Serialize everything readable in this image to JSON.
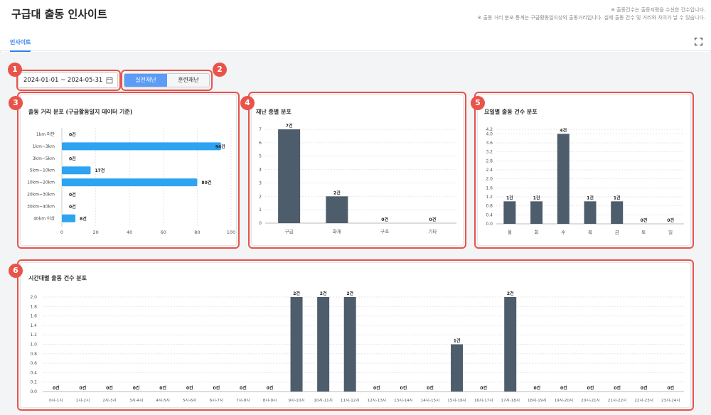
{
  "header": {
    "title": "구급대 출동 인사이트",
    "note1": "※ 출동건수는 출동지령을 수신한 건수입니다.",
    "note2": "※ 출동 거리 분포 통계는 구급활동일지상의 출동거리입니다. 실제 출동 건수 및 거리와 차이가 날 수 있습니다.",
    "tab": "인사이트"
  },
  "filters": {
    "date_range": "2024-01-01 ~ 2024-05-31",
    "toggle_on": "실전재난",
    "toggle_off": "훈련재난"
  },
  "badges": [
    "1",
    "2",
    "3",
    "4",
    "5",
    "6"
  ],
  "cards": {
    "distance": {
      "title": "출동 거리 분포 (구급활동일지 데이터 기준)"
    },
    "type": {
      "title": "재난 종별 분포"
    },
    "weekday": {
      "title": "요일별 출동 건수 분포"
    },
    "hourly": {
      "title": "시간대별 출동 건수 분포"
    }
  },
  "colors": {
    "accent": "#2f80ed",
    "hbar": "#2ea3f2",
    "vbar": "#4e5d6c",
    "callout": "#e8534a"
  },
  "chart_data": [
    {
      "id": "distance",
      "type": "bar",
      "orientation": "horizontal",
      "categories": [
        "1km 미만",
        "1km~3km",
        "3km~5km",
        "5km~10km",
        "10km~20km",
        "20km~30km",
        "30km~40km",
        "40km 이상"
      ],
      "values": [
        0,
        94,
        0,
        17,
        80,
        0,
        0,
        8
      ],
      "labels": [
        "0건",
        "94건",
        "0건",
        "17건",
        "80건",
        "0건",
        "0건",
        "8건"
      ],
      "xlim": [
        0,
        100
      ],
      "ticks": [
        0,
        20,
        40,
        60,
        80,
        100
      ]
    },
    {
      "id": "type",
      "type": "bar",
      "categories": [
        "구급",
        "화재",
        "구조",
        "기타"
      ],
      "values": [
        7,
        2,
        0,
        0
      ],
      "labels": [
        "7건",
        "2건",
        "0건",
        "0건"
      ],
      "ylim": [
        0,
        7
      ],
      "ticks": [
        0,
        1,
        2,
        3,
        4,
        5,
        6,
        7
      ]
    },
    {
      "id": "weekday",
      "type": "bar",
      "categories": [
        "월",
        "화",
        "수",
        "목",
        "금",
        "토",
        "일"
      ],
      "values": [
        1,
        1,
        4,
        1,
        1,
        0,
        0
      ],
      "labels": [
        "1건",
        "1건",
        "4건",
        "1건",
        "1건",
        "0건",
        "0건"
      ],
      "ylim": [
        0,
        4.2
      ],
      "ticks": [
        "0.0",
        "0.4",
        "0.8",
        "1.2",
        "1.6",
        "2.0",
        "2.4",
        "2.8",
        "3.2",
        "3.6",
        "4.0",
        "4.2"
      ]
    },
    {
      "id": "hourly",
      "type": "bar",
      "categories": [
        "0시-1시",
        "1시-2시",
        "2시-3시",
        "3시-4시",
        "4시-5시",
        "5시-6시",
        "6시-7시",
        "7시-8시",
        "8시-9시",
        "9시-10시",
        "10시-11시",
        "11시-12시",
        "12시-13시",
        "13시-14시",
        "14시-15시",
        "15시-16시",
        "16시-17시",
        "17시-18시",
        "18시-19시",
        "19시-20시",
        "20시-21시",
        "21시-22시",
        "22시-23시",
        "23시-24시"
      ],
      "values": [
        0,
        0,
        0,
        0,
        0,
        0,
        0,
        0,
        0,
        2,
        2,
        2,
        0,
        0,
        0,
        1,
        0,
        2,
        0,
        0,
        0,
        0,
        0,
        0
      ],
      "labels": [
        "0건",
        "0건",
        "0건",
        "0건",
        "0건",
        "0건",
        "0건",
        "0건",
        "0건",
        "2건",
        "2건",
        "2건",
        "0건",
        "0건",
        "0건",
        "1건",
        "0건",
        "2건",
        "0건",
        "0건",
        "0건",
        "0건",
        "0건",
        "0건"
      ],
      "ylim": [
        0,
        2
      ],
      "ticks": [
        "0.0",
        "0.2",
        "0.4",
        "0.6",
        "0.8",
        "1.0",
        "1.2",
        "1.4",
        "1.6",
        "1.8",
        "2.0"
      ]
    }
  ]
}
